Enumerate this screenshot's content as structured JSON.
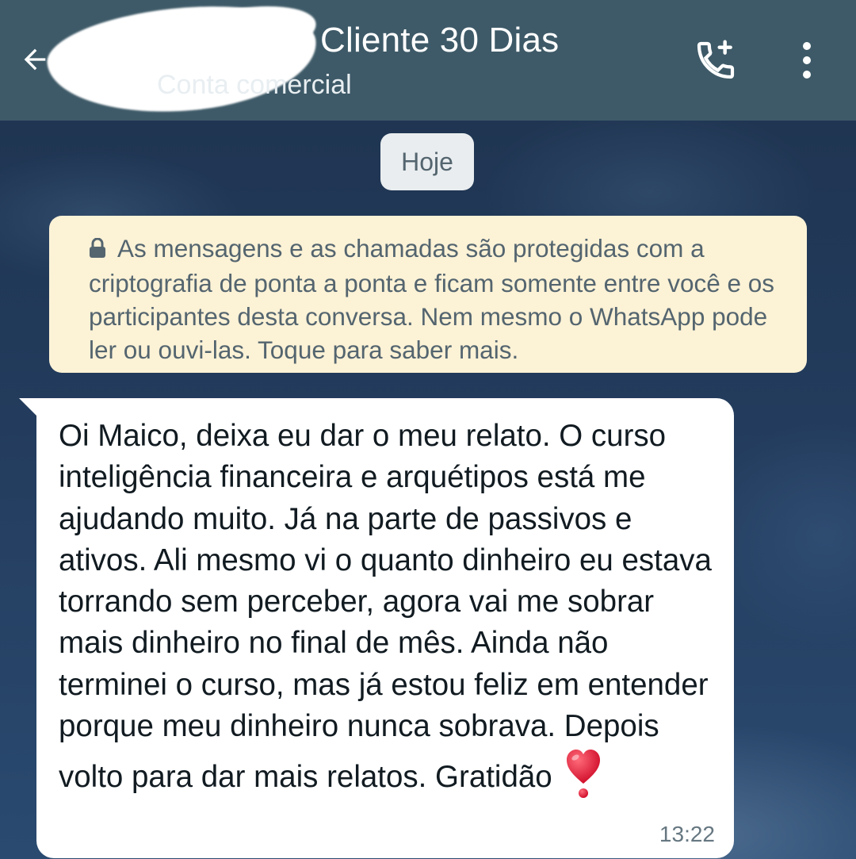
{
  "header": {
    "back_icon": "arrow-left-icon",
    "contact_name": "Cliente 30 Dias",
    "contact_subtitle": "Conta comercial",
    "call_icon": "phone-add-icon",
    "menu_icon": "more-vertical-icon",
    "bg_color": "#3e5a68"
  },
  "chat": {
    "date_label": "Hoje",
    "encryption_notice": {
      "icon": "lock-icon",
      "text": "As mensagens e as chamadas são protegidas com a criptografia de ponta a ponta e ficam somente entre você e os participantes desta conversa. Nem mesmo o WhatsApp pode ler ou ouvi-las. Toque para saber mais."
    },
    "messages": [
      {
        "direction": "incoming",
        "text": "Oi Maico, deixa eu dar o meu relato. O curso inteligência financeira e arquétipos está me ajudando muito. Já na parte de passivos e ativos. Ali mesmo vi o quanto dinheiro eu estava torrando sem perceber, agora vai me sobrar mais dinheiro no final de mês. Ainda não terminei o curso, mas já estou feliz em entender porque meu dinheiro nunca sobrava. Depois volto para dar mais relatos. Gratidão",
        "emoji": "heart-exclamation-icon",
        "time": "13:22"
      }
    ]
  }
}
